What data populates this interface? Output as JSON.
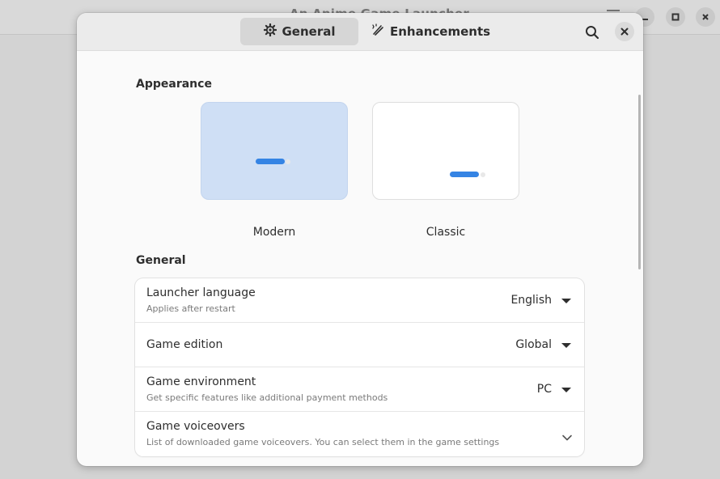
{
  "background_app": {
    "title": "An Anime Game Launcher"
  },
  "dialog": {
    "tabs": [
      {
        "label": "General",
        "icon": "gear-icon",
        "active": true
      },
      {
        "label": "Enhancements",
        "icon": "magic-brush-icon",
        "active": false
      }
    ],
    "appearance": {
      "section_title": "Appearance",
      "options": [
        {
          "label": "Modern",
          "selected": true
        },
        {
          "label": "Classic",
          "selected": false
        }
      ]
    },
    "general": {
      "section_title": "General",
      "rows": [
        {
          "title": "Launcher language",
          "subtitle": "Applies after restart",
          "value": "English",
          "control": "dropdown"
        },
        {
          "title": "Game edition",
          "subtitle": "",
          "value": "Global",
          "control": "dropdown"
        },
        {
          "title": "Game environment",
          "subtitle": "Get specific features like additional payment methods",
          "value": "PC",
          "control": "dropdown"
        },
        {
          "title": "Game voiceovers",
          "subtitle": "List of downloaded game voiceovers. You can select them in the game settings",
          "value": "",
          "control": "expander"
        }
      ]
    }
  },
  "colors": {
    "accent": "#3584e4",
    "selected_card": "#cfdff5"
  }
}
